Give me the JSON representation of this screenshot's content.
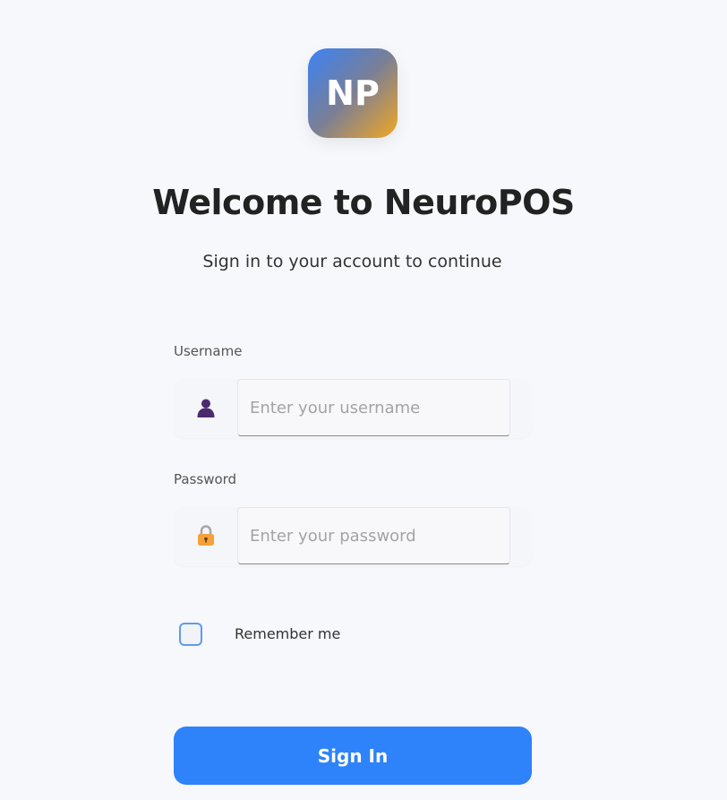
{
  "logo": {
    "text": "NP"
  },
  "header": {
    "title": "Welcome to NeuroPOS",
    "subtitle": "Sign in to your account to continue"
  },
  "form": {
    "username": {
      "label": "Username",
      "placeholder": "Enter your username",
      "value": "",
      "icon": "user-icon"
    },
    "password": {
      "label": "Password",
      "placeholder": "Enter your password",
      "value": "",
      "icon": "lock-icon"
    },
    "remember_me": {
      "label": "Remember me",
      "checked": false
    },
    "submit_label": "Sign In"
  },
  "colors": {
    "background": "#f7f8fc",
    "accent": "#2e82fa",
    "checkbox_border": "#5b9cf2",
    "title": "#222222"
  }
}
